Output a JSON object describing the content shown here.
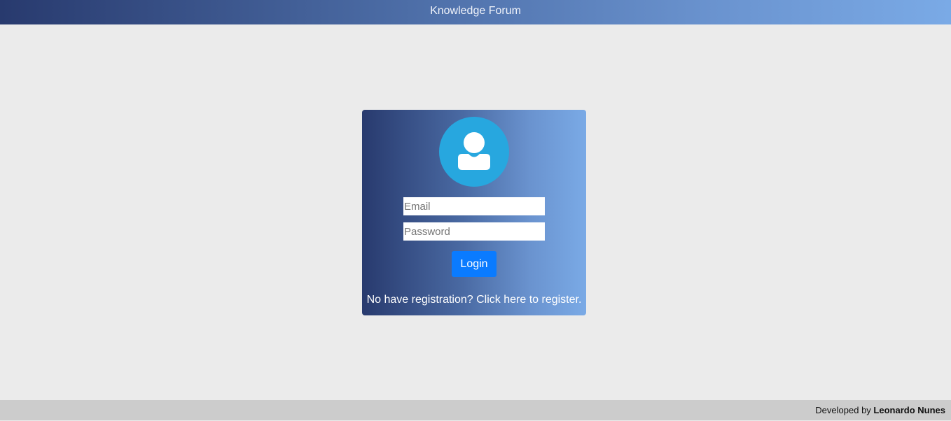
{
  "header": {
    "title": "Knowledge Forum"
  },
  "login_card": {
    "avatar_icon": "user-icon",
    "email_placeholder": "Email",
    "password_placeholder": "Password",
    "login_label": "Login",
    "register_text": "No have registration? Click here to register."
  },
  "footer": {
    "prefix": "Developed by",
    "author": "Leonardo Nunes"
  },
  "colors": {
    "header_gradient_start": "#283a6e",
    "header_gradient_end": "#7aaae6",
    "avatar_background": "#27a7df",
    "login_button": "#0a7bff",
    "page_background": "#ebebeb",
    "footer_background": "#cccccc"
  }
}
